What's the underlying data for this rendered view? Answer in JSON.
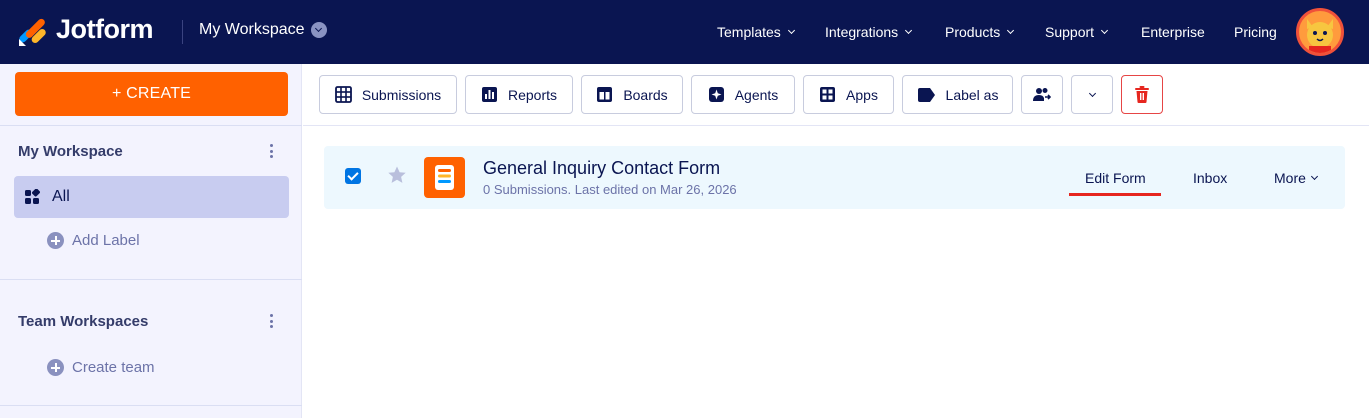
{
  "brand": {
    "name": "Jotform"
  },
  "workspace_switch": {
    "label": "My Workspace"
  },
  "nav": {
    "templates": "Templates",
    "integrations": "Integrations",
    "products": "Products",
    "support": "Support",
    "enterprise": "Enterprise",
    "pricing": "Pricing"
  },
  "sidebar": {
    "create_label": "+ CREATE",
    "my_workspace": "My Workspace",
    "all_label": "All",
    "add_label": "Add Label",
    "team_workspaces": "Team Workspaces",
    "create_team": "Create team"
  },
  "toolbar": {
    "submissions": "Submissions",
    "reports": "Reports",
    "boards": "Boards",
    "agents": "Agents",
    "apps": "Apps",
    "label_as": "Label as"
  },
  "form": {
    "title": "General Inquiry Contact Form",
    "meta": "0 Submissions. Last edited on Mar 26, 2026",
    "checked": true,
    "edit_form": "Edit Form",
    "inbox": "Inbox",
    "more": "More"
  },
  "colors": {
    "navy": "#0a1551",
    "create_orange": "#ff6100",
    "sidebar_bg": "#f3f3fe",
    "selected_bg": "#c8ccf0",
    "row_bg": "#edf8fe",
    "accent_red": "#e6261f",
    "checkbox_blue": "#0075e3"
  }
}
